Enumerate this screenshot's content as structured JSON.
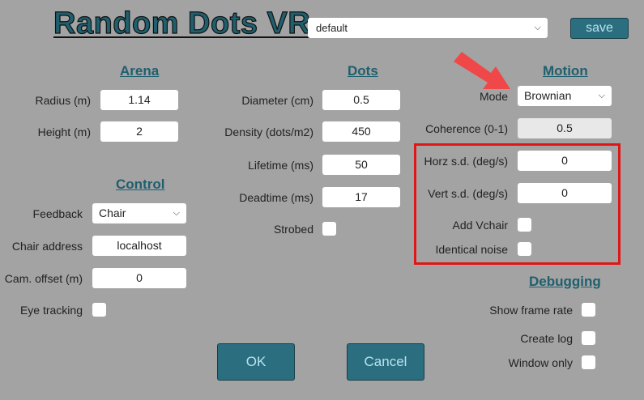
{
  "app_title": "Random Dots VR",
  "preset": {
    "value": "default"
  },
  "save_label": "save",
  "arena": {
    "heading": "Arena",
    "radius_label": "Radius (m)",
    "radius_value": "1.14",
    "height_label": "Height (m)",
    "height_value": "2"
  },
  "control": {
    "heading": "Control",
    "feedback_label": "Feedback",
    "feedback_value": "Chair",
    "chair_address_label": "Chair address",
    "chair_address_value": "localhost",
    "cam_offset_label": "Cam. offset (m)",
    "cam_offset_value": "0",
    "eye_tracking_label": "Eye tracking"
  },
  "dots": {
    "heading": "Dots",
    "diameter_label": "Diameter (cm)",
    "diameter_value": "0.5",
    "density_label": "Density (dots/m2)",
    "density_value": "450",
    "lifetime_label": "Lifetime (ms)",
    "lifetime_value": "50",
    "deadtime_label": "Deadtime (ms)",
    "deadtime_value": "17",
    "strobed_label": "Strobed"
  },
  "motion": {
    "heading": "Motion",
    "mode_label": "Mode",
    "mode_value": "Brownian",
    "coherence_label": "Coherence (0-1)",
    "coherence_value": "0.5",
    "horz_label": "Horz s.d. (deg/s)",
    "horz_value": "0",
    "vert_label": "Vert s.d. (deg/s)",
    "vert_value": "0",
    "add_vchair_label": "Add Vchair",
    "identical_noise_label": "Identical noise"
  },
  "debugging": {
    "heading": "Debugging",
    "show_frame_rate_label": "Show frame rate",
    "create_log_label": "Create log",
    "window_only_label": "Window only"
  },
  "ok_label": "OK",
  "cancel_label": "Cancel",
  "colors": {
    "accent": "#2a6e80",
    "highlight": "#e01616",
    "arrow": "#f04848"
  }
}
